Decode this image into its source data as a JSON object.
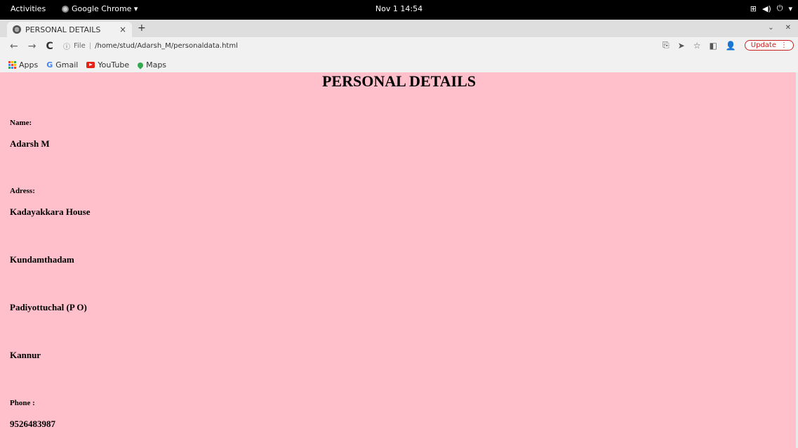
{
  "topbar": {
    "activities": "Activities",
    "app_name": "Google Chrome ▾",
    "clock": "Nov 1  14:54"
  },
  "browser": {
    "tab_title": "PERSONAL DETAILS",
    "tab_close": "×",
    "new_tab": "+",
    "url_scheme": "File",
    "url_path": "/home/stud/Adarsh_M/personaldata.html",
    "update_label": "Update",
    "bookmarks": {
      "apps": "Apps",
      "gmail": "Gmail",
      "youtube": "YouTube",
      "maps": "Maps"
    }
  },
  "page": {
    "background": "#ffc0cb",
    "title": "PERSONAL DETAILS",
    "name_label": "Name:",
    "name_value": "Adarsh M",
    "address_label": "Adress:",
    "address_lines": [
      "Kadayakkara House",
      "Kundamthadam",
      "Padiyottuchal (P O)",
      "Kannur"
    ],
    "phone_label": "Phone :",
    "phone_value": "9526483987"
  }
}
